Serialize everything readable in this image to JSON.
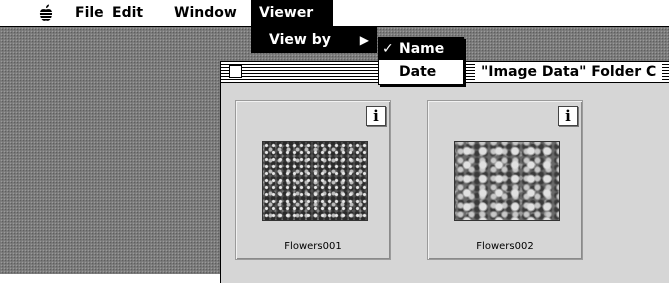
{
  "menubar": {
    "apple": "",
    "items": [
      {
        "label": "File"
      },
      {
        "label": "Edit"
      },
      {
        "label": "Window"
      },
      {
        "label": "Viewer"
      }
    ]
  },
  "viewer_menu": {
    "items": [
      {
        "label": "View by",
        "submenu_arrow": "▶"
      }
    ]
  },
  "view_by_submenu": {
    "items": [
      {
        "label": "Name",
        "checked": true,
        "check": "✓"
      },
      {
        "label": "Date",
        "checked": false
      }
    ]
  },
  "window": {
    "title": "\"Image Data\" Folder C"
  },
  "files": [
    {
      "name": "Flowers001",
      "info_label": "i"
    },
    {
      "name": "Flowers002",
      "info_label": "i"
    }
  ]
}
